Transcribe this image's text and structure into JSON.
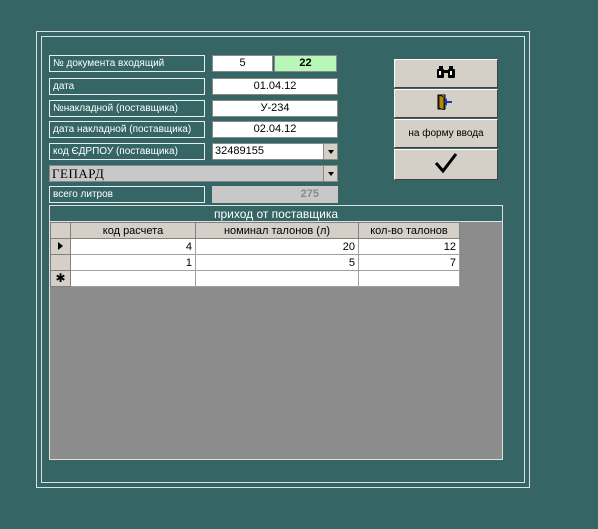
{
  "form": {
    "doc_label": "№ документа входящий",
    "doc_number": "5",
    "doc_counter": "22",
    "date_label": "дата",
    "date_value": "01.04.12",
    "invoice_label": "№накладной (поставщика)",
    "invoice_value": "У-234",
    "invoice_date_label": "дата накладной (поставщика)",
    "invoice_date_value": "02.04.12",
    "edrpou_label": "код ЄДРПОУ (поставщика)",
    "edrpou_value": "32489155",
    "supplier_name": "ГЕПАРД",
    "total_label": "всего литров",
    "total_value": "275",
    "counter_color": "#b8f7b8"
  },
  "buttons": {
    "find_icon": "binoculars-icon",
    "exit_icon": "exit-door-icon",
    "to_input_label": "на форму ввода",
    "confirm_icon": "checkmark-icon"
  },
  "grid": {
    "title": "приход от поставщика",
    "columns": [
      "код расчета",
      "номинал талонов (л)",
      "кол-во талонов"
    ],
    "rows": [
      [
        "4",
        "20",
        "12"
      ],
      [
        "1",
        "5",
        "7"
      ]
    ]
  }
}
